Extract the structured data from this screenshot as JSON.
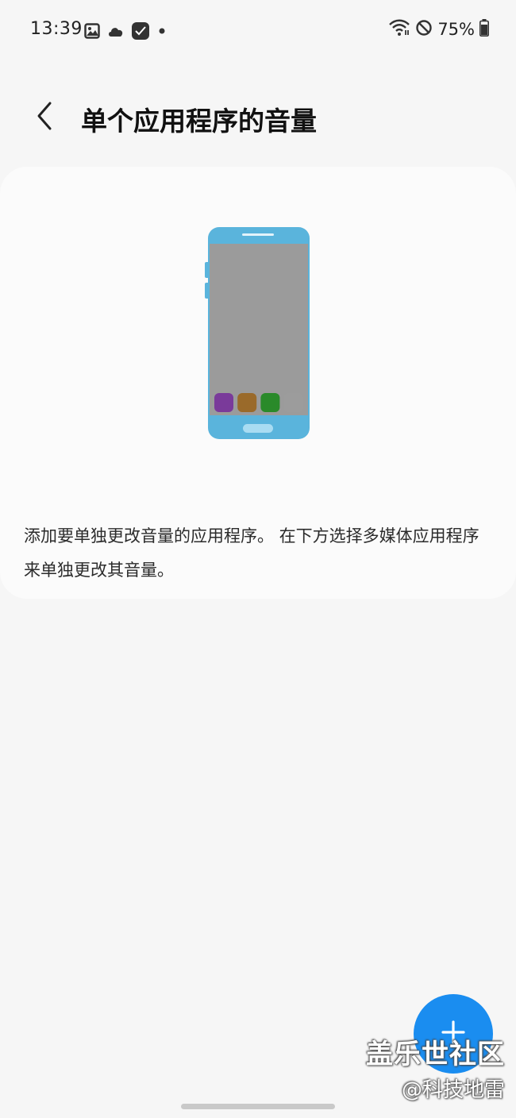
{
  "status_bar": {
    "time": "13:39",
    "left_icons": [
      "gallery-icon",
      "cloud-icon",
      "app-check-icon",
      "notification-dot-icon"
    ],
    "right_icons": [
      "wifi-icon",
      "do-not-disturb-icon",
      "battery-icon"
    ],
    "battery_text": "75%"
  },
  "header": {
    "title": "单个应用程序的音量",
    "back_icon": "chevron-left-icon"
  },
  "card": {
    "illustration": {
      "phone_color": "#5ab4dc",
      "screen_color": "#9b9b9b",
      "app_colors": [
        "#7a3a9a",
        "#9a6a2a",
        "#2a8a2a",
        "#9c9c9c"
      ]
    },
    "description": "添加要单独更改音量的应用程序。 在下方选择多媒体应用程序来单独更改其音量。"
  },
  "fab": {
    "icon": "plus-icon",
    "color": "#1a8df0"
  },
  "watermark": {
    "line1": "盖乐世社区",
    "line2": "@科技地雷"
  }
}
